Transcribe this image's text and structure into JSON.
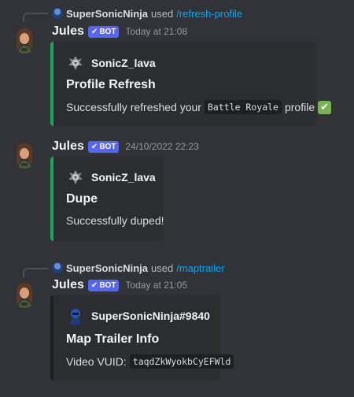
{
  "messages": [
    {
      "reply": {
        "user": "SuperSonicNinja",
        "used": "used",
        "command": "/refresh-profile"
      },
      "author": "Jules",
      "bot_label": "BOT",
      "timestamp": "Today at 21:08",
      "embed": {
        "author": "SonicZ_lava",
        "title": "Profile Refresh",
        "desc_prefix": "Successfully refreshed your",
        "desc_code": "Battle Royale",
        "desc_suffix": "profile",
        "emoji": "✔"
      }
    },
    {
      "author": "Jules",
      "bot_label": "BOT",
      "timestamp": "24/10/2022 22:23",
      "embed": {
        "author": "SonicZ_lava",
        "title": "Dupe",
        "description": "Successfully duped!"
      }
    },
    {
      "reply": {
        "user": "SuperSonicNinja",
        "used": "used",
        "command": "/maptrailer"
      },
      "author": "Jules",
      "bot_label": "BOT",
      "timestamp": "Today at 21:05",
      "embed": {
        "author": "SuperSonicNinja#9840",
        "title": "Map Trailer Info",
        "desc_prefix": "Video VUID:",
        "desc_code": "taqdZkWyokbCyEFWld"
      }
    }
  ],
  "colors": {
    "background": "#313338",
    "embed_bg": "#2b2d31",
    "accent_green": "#23a559",
    "bot_tag": "#5865f2",
    "command_link": "#00a8fc"
  },
  "icons": {
    "bot_tag": "checkmark-icon",
    "emoji": "white-check-mark-icon"
  }
}
